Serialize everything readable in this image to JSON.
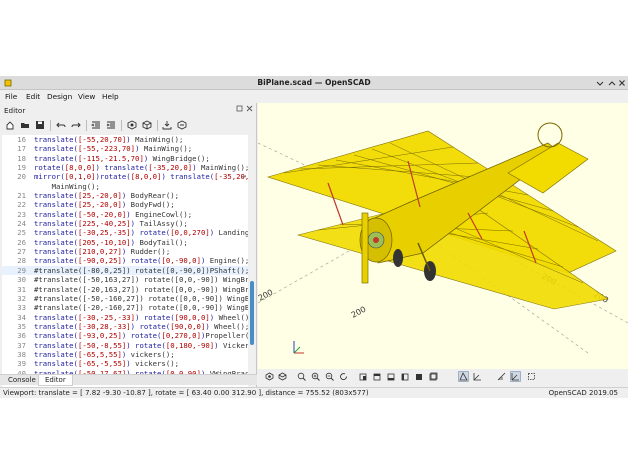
{
  "window": {
    "title": "BiPlane.scad — OpenSCAD"
  },
  "menu": [
    "File",
    "Edit",
    "Design",
    "View",
    "Help"
  ],
  "editor": {
    "label": "Editor",
    "lines": [
      {
        "n": "16",
        "parts": [
          [
            "t",
            "translate("
          ],
          [
            "v",
            "[-55,20,70]"
          ],
          [
            "t",
            ") "
          ],
          [
            "c",
            "MainWing();"
          ]
        ]
      },
      {
        "n": "17",
        "parts": [
          [
            "t",
            "translate("
          ],
          [
            "v",
            "[-55,-223,70]"
          ],
          [
            "t",
            ") "
          ],
          [
            "c",
            "MainWing();"
          ]
        ]
      },
      {
        "n": "18",
        "parts": [
          [
            "t",
            "translate("
          ],
          [
            "v",
            "[-115,-21.5,70]"
          ],
          [
            "t",
            ") "
          ],
          [
            "c",
            "WingBridge();"
          ]
        ]
      },
      {
        "n": "19",
        "parts": [
          [
            "t",
            "rotate("
          ],
          [
            "v",
            "[8,0,0]"
          ],
          [
            "t",
            ") translate("
          ],
          [
            "v",
            "[-35,20,0]"
          ],
          [
            "t",
            ") "
          ],
          [
            "c",
            "MainWing();"
          ]
        ]
      },
      {
        "n": "20",
        "parts": [
          [
            "t",
            "mirror("
          ],
          [
            "v",
            "[0,1,0]"
          ],
          [
            "t",
            ")rotate("
          ],
          [
            "v",
            "[8,0,0]"
          ],
          [
            "t",
            ") translate("
          ],
          [
            "v",
            "[-35,20,0]"
          ],
          [
            "t",
            ")"
          ]
        ],
        "wrap": true
      },
      {
        "n": "",
        "parts": [
          [
            "c",
            "    MainWing();"
          ]
        ]
      },
      {
        "n": "21",
        "parts": [
          [
            "t",
            "translate("
          ],
          [
            "v",
            "[25,-20,0]"
          ],
          [
            "t",
            ") "
          ],
          [
            "c",
            "BodyRear();"
          ]
        ]
      },
      {
        "n": "22",
        "parts": [
          [
            "t",
            "translate("
          ],
          [
            "v",
            "[25,-20,0]"
          ],
          [
            "t",
            ") "
          ],
          [
            "c",
            "BodyFwd();"
          ]
        ]
      },
      {
        "n": "23",
        "parts": [
          [
            "t",
            "translate("
          ],
          [
            "v",
            "[-50,-20,0]"
          ],
          [
            "t",
            ") "
          ],
          [
            "c",
            "EngineCowl();"
          ]
        ]
      },
      {
        "n": "24",
        "parts": [
          [
            "t",
            "translate("
          ],
          [
            "v",
            "[225,-40,25]"
          ],
          [
            "t",
            ") "
          ],
          [
            "c",
            "TailAssy();"
          ]
        ]
      },
      {
        "n": "25",
        "parts": [
          [
            "t",
            "translate("
          ],
          [
            "v",
            "[-30,25,-35]"
          ],
          [
            "t",
            ") rotate("
          ],
          [
            "v",
            "[0,0,270]"
          ],
          [
            "t",
            ") "
          ],
          [
            "c",
            "LandingStrut();"
          ]
        ]
      },
      {
        "n": "26",
        "parts": [
          [
            "t",
            "translate("
          ],
          [
            "v",
            "[205,-10,10]"
          ],
          [
            "t",
            ") "
          ],
          [
            "c",
            "BodyTail();"
          ]
        ]
      },
      {
        "n": "27",
        "parts": [
          [
            "t",
            "translate("
          ],
          [
            "v",
            "[210,0,27]"
          ],
          [
            "t",
            ") "
          ],
          [
            "c",
            "Rudder();"
          ]
        ]
      },
      {
        "n": "28",
        "parts": [
          [
            "t",
            "translate("
          ],
          [
            "v",
            "[-90,0,25]"
          ],
          [
            "t",
            ") rotate("
          ],
          [
            "v",
            "[0,-90,0]"
          ],
          [
            "t",
            ") "
          ],
          [
            "c",
            "Engine();"
          ]
        ]
      },
      {
        "n": "29",
        "cur": true,
        "parts": [
          [
            "c",
            "#translate([-8"
          ],
          [
            "c",
            "0,0,25]) rotate([0,-90,0])PShaft();"
          ]
        ]
      },
      {
        "n": "30",
        "parts": [
          [
            "c",
            "#translate([-50,163,27]) rotate([0,0,-90]) WingBrace();"
          ]
        ]
      },
      {
        "n": "31",
        "parts": [
          [
            "c",
            "#translate([-20,163,27]) rotate([0,0,-90]) WingBrace();"
          ]
        ]
      },
      {
        "n": "32",
        "parts": [
          [
            "c",
            "#translate([-50,-160,27]) rotate([0,0,-90]) WingBrace();"
          ]
        ]
      },
      {
        "n": "33",
        "parts": [
          [
            "c",
            "#translate([-20,-160,27]) rotate([0,0,-90]) WingBrace();"
          ]
        ]
      },
      {
        "n": "34",
        "parts": [
          [
            "t",
            "translate("
          ],
          [
            "v",
            "[-30,-25,-33]"
          ],
          [
            "t",
            ") rotate("
          ],
          [
            "v",
            "[90,0,0]"
          ],
          [
            "t",
            ") "
          ],
          [
            "c",
            "Wheel();"
          ]
        ]
      },
      {
        "n": "35",
        "parts": [
          [
            "t",
            "translate("
          ],
          [
            "v",
            "[-30,28,-33]"
          ],
          [
            "t",
            ") rotate("
          ],
          [
            "v",
            "[90,0,0]"
          ],
          [
            "t",
            ") "
          ],
          [
            "c",
            "Wheel();"
          ]
        ]
      },
      {
        "n": "36",
        "parts": [
          [
            "t",
            "translate("
          ],
          [
            "v",
            "[-93,0,25]"
          ],
          [
            "t",
            ") rotate("
          ],
          [
            "v",
            "[0,270,0]"
          ],
          [
            "t",
            ")"
          ],
          [
            "c",
            "Propeller();"
          ]
        ]
      },
      {
        "n": "37",
        "parts": [
          [
            "t",
            "translate("
          ],
          [
            "v",
            "[-50,-8,55]"
          ],
          [
            "t",
            ") rotate("
          ],
          [
            "v",
            "[0,180,-90]"
          ],
          [
            "t",
            ") "
          ],
          [
            "c",
            "VickersMount();"
          ]
        ]
      },
      {
        "n": "38",
        "parts": [
          [
            "t",
            "translate("
          ],
          [
            "v",
            "[-65,5,55]"
          ],
          [
            "t",
            ") "
          ],
          [
            "c",
            "vickers();"
          ]
        ]
      },
      {
        "n": "39",
        "parts": [
          [
            "t",
            "translate("
          ],
          [
            "v",
            "[-65,-5,55]"
          ],
          [
            "t",
            ") "
          ],
          [
            "c",
            "vickers();"
          ]
        ]
      },
      {
        "n": "40",
        "parts": [
          [
            "t",
            "translate("
          ],
          [
            "v",
            "[-50,17.67]"
          ],
          [
            "t",
            ") rotate("
          ],
          [
            "v",
            "[0,0,90]"
          ],
          [
            "t",
            ") "
          ],
          [
            "c",
            "VWingBrace();"
          ]
        ]
      }
    ]
  },
  "tabs": {
    "console": "Console",
    "editor": "Editor"
  },
  "axis_labels": [
    "200",
    "200",
    "200",
    "200"
  ],
  "status": {
    "viewport": "Viewport: translate = [ 7.82 -9.30 -10.87 ], rotate = [ 63.40 0.00 312.90 ], distance = 755.52 (803x577)",
    "version": "OpenSCAD 2019.05"
  },
  "colors": {
    "viewport_bg": "#ffffe5",
    "model": "#f2dc00",
    "brace": "#c0392b",
    "editor_bg": "#ffffff",
    "accent": "#4a8ec8"
  },
  "icons": {
    "editor_toolbar": [
      "new-file-icon",
      "open-file-icon",
      "save-icon",
      "undo-icon",
      "redo-icon",
      "unindent-icon",
      "indent-icon",
      "preview-icon",
      "render-icon",
      "export-stl-icon",
      "send-to-print-icon"
    ],
    "view_toolbar": [
      "preview-icon",
      "render-icon",
      "view-all-icon",
      "zoom-in-icon",
      "zoom-out-icon",
      "reset-view-icon",
      "view-right-icon",
      "view-top-icon",
      "view-bottom-icon",
      "view-left-icon",
      "view-front-icon",
      "view-back-icon",
      "perspective-icon",
      "orthogonal-icon",
      "show-axes-icon",
      "show-scale-icon",
      "show-edges-icon"
    ]
  }
}
